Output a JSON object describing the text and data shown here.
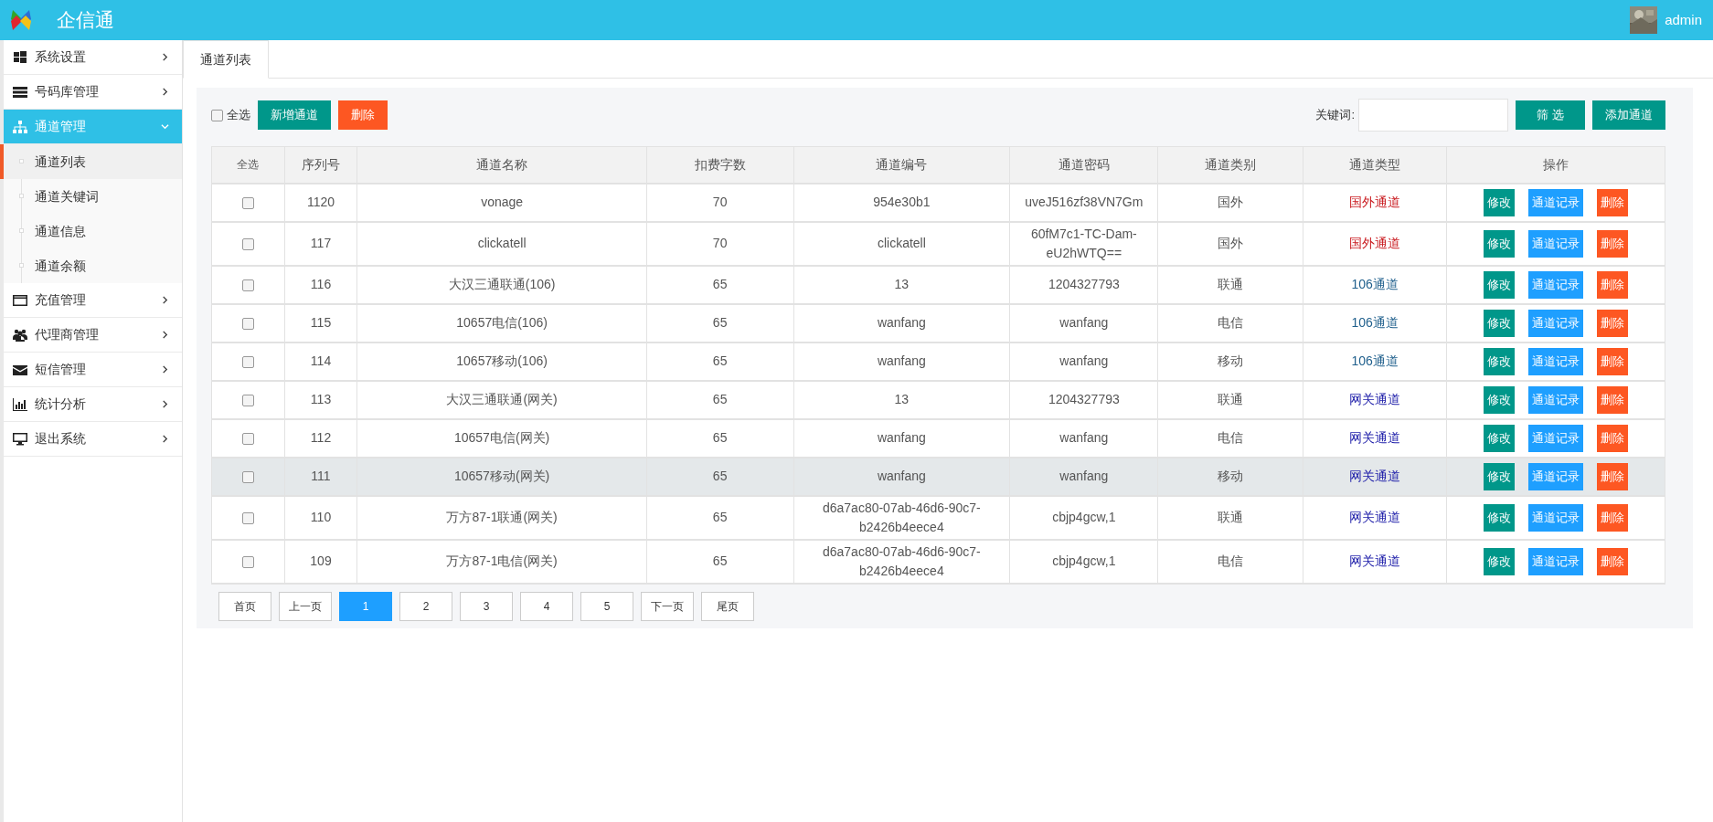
{
  "header": {
    "title": "企信通",
    "user": "admin"
  },
  "sidebar": {
    "items": [
      {
        "label": "系统设置",
        "expanded": false,
        "selected": false
      },
      {
        "label": "号码库管理",
        "expanded": false,
        "selected": false
      },
      {
        "label": "通道管理",
        "expanded": true,
        "selected": true,
        "children": [
          {
            "label": "通道列表",
            "selected": true
          },
          {
            "label": "通道关键词",
            "selected": false
          },
          {
            "label": "通道信息",
            "selected": false
          },
          {
            "label": "通道余额",
            "selected": false
          }
        ]
      },
      {
        "label": "充值管理",
        "expanded": false,
        "selected": false
      },
      {
        "label": "代理商管理",
        "expanded": false,
        "selected": false
      },
      {
        "label": "短信管理",
        "expanded": false,
        "selected": false
      },
      {
        "label": "统计分析",
        "expanded": false,
        "selected": false
      },
      {
        "label": "退出系统",
        "expanded": false,
        "selected": false
      }
    ]
  },
  "tabs": [
    {
      "label": "通道列表"
    }
  ],
  "toolbar": {
    "select_all": {
      "label": "全选",
      "checked": false
    },
    "add_button": "新增通道",
    "delete_button": "删除",
    "keyword_label": "关键词:",
    "filter_button": "筛 选",
    "add_channel_button": "添加通道"
  },
  "table": {
    "columns": [
      "全选",
      "序列号",
      "通道名称",
      "扣费字数",
      "通道编号",
      "通道密码",
      "通道类别",
      "通道类型",
      "操作"
    ],
    "rows": [
      {
        "checked": false,
        "hovered": false,
        "id": "1120",
        "name": "vonage",
        "chars": "70",
        "code": "954e30b1",
        "password": "uveJ516zf38VN7Gm",
        "category": "国外",
        "type": "国外通道",
        "color": "#c9191e",
        "actions": [
          "修改",
          "通道记录",
          "删除"
        ]
      },
      {
        "checked": false,
        "hovered": false,
        "id": "117",
        "name": "clickatell",
        "chars": "70",
        "code": "clickatell",
        "password": "60fM7c1-TC-Dam-eU2hWTQ==",
        "category": "国外",
        "type": "国外通道",
        "color": "#c9191e",
        "actions": [
          "修改",
          "通道记录",
          "删除"
        ]
      },
      {
        "checked": false,
        "hovered": false,
        "id": "116",
        "name": "大汉三通联通(106)",
        "chars": "65",
        "code": "13",
        "password": "1204327793",
        "category": "联通",
        "type": "106通道",
        "color": "#1f5f8c",
        "actions": [
          "修改",
          "通道记录",
          "删除"
        ]
      },
      {
        "checked": false,
        "hovered": false,
        "id": "115",
        "name": "10657电信(106)",
        "chars": "65",
        "code": "wanfang",
        "password": "wanfang",
        "category": "电信",
        "type": "106通道",
        "color": "#1f5f8c",
        "actions": [
          "修改",
          "通道记录",
          "删除"
        ]
      },
      {
        "checked": false,
        "hovered": false,
        "id": "114",
        "name": "10657移动(106)",
        "chars": "65",
        "code": "wanfang",
        "password": "wanfang",
        "category": "移动",
        "type": "106通道",
        "color": "#1f5f8c",
        "actions": [
          "修改",
          "通道记录",
          "删除"
        ]
      },
      {
        "checked": false,
        "hovered": false,
        "id": "113",
        "name": "大汉三通联通(网关)",
        "chars": "65",
        "code": "13",
        "password": "1204327793",
        "category": "联通",
        "type": "网关通道",
        "color": "#1b1ba8",
        "actions": [
          "修改",
          "通道记录",
          "删除"
        ]
      },
      {
        "checked": false,
        "hovered": false,
        "id": "112",
        "name": "10657电信(网关)",
        "chars": "65",
        "code": "wanfang",
        "password": "wanfang",
        "category": "电信",
        "type": "网关通道",
        "color": "#1b1ba8",
        "actions": [
          "修改",
          "通道记录",
          "删除"
        ]
      },
      {
        "checked": false,
        "hovered": true,
        "id": "111",
        "name": "10657移动(网关)",
        "chars": "65",
        "code": "wanfang",
        "password": "wanfang",
        "category": "移动",
        "type": "网关通道",
        "color": "#1b1ba8",
        "actions": [
          "修改",
          "通道记录",
          "删除"
        ]
      },
      {
        "checked": false,
        "hovered": false,
        "id": "110",
        "name": "万方87-1联通(网关)",
        "chars": "65",
        "code": "d6a7ac80-07ab-46d6-90c7-b2426b4eece4",
        "password": "cbjp4gcw,1",
        "category": "联通",
        "type": "网关通道",
        "color": "#1b1ba8",
        "actions": [
          "修改",
          "通道记录",
          "删除"
        ]
      },
      {
        "checked": false,
        "hovered": false,
        "id": "109",
        "name": "万方87-1电信(网关)",
        "chars": "65",
        "code": "d6a7ac80-07ab-46d6-90c7-b2426b4eece4",
        "password": "cbjp4gcw,1",
        "category": "电信",
        "type": "网关通道",
        "color": "#1b1ba8",
        "actions": [
          "修改",
          "通道记录",
          "删除"
        ]
      }
    ]
  },
  "pagination": {
    "first": "首页",
    "prev": "上一页",
    "pages": [
      {
        "label": "1",
        "selected": true
      },
      {
        "label": "2",
        "selected": false
      },
      {
        "label": "3",
        "selected": false
      },
      {
        "label": "4",
        "selected": false
      },
      {
        "label": "5",
        "selected": false
      }
    ],
    "next": "下一页",
    "last": "尾页"
  }
}
